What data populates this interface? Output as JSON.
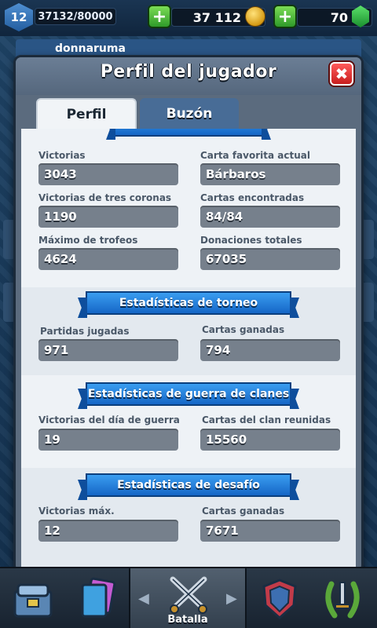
{
  "topbar": {
    "level": "12",
    "xp": "37132/80000",
    "gold": "37 112",
    "gems": "70",
    "player_name": "donnaruma"
  },
  "modal": {
    "title": "Perfil del jugador",
    "close_label": "✖",
    "tabs": [
      {
        "label": "Perfil",
        "active": true
      },
      {
        "label": "Buzón",
        "active": false
      }
    ]
  },
  "profile": {
    "stats": [
      {
        "label": "Victorias",
        "value": "3043"
      },
      {
        "label": "Carta favorita actual",
        "value": "Bárbaros"
      },
      {
        "label": "Victorias de tres coronas",
        "value": "1190"
      },
      {
        "label": "Cartas encontradas",
        "value": "84/84"
      },
      {
        "label": "Máximo de trofeos",
        "value": "4624"
      },
      {
        "label": "Donaciones totales",
        "value": "67035"
      }
    ]
  },
  "tournament": {
    "title": "Estadísticas de torneo",
    "stats": [
      {
        "label": "Partidas jugadas",
        "value": "971"
      },
      {
        "label": "Cartas ganadas",
        "value": "794"
      }
    ]
  },
  "clan_war": {
    "title": "Estadísticas de guerra de clanes",
    "stats": [
      {
        "label": "Victorias del día de guerra",
        "value": "19"
      },
      {
        "label": "Cartas del clan reunidas",
        "value": "15560"
      }
    ]
  },
  "challenge": {
    "title": "Estadísticas de desafío",
    "stats": [
      {
        "label": "Victorias máx.",
        "value": "12"
      },
      {
        "label": "Cartas ganadas",
        "value": "7671"
      }
    ]
  },
  "bottom_nav": {
    "active_label": "Batalla",
    "items": [
      "shop-icon",
      "cards-icon",
      "battle-swords-icon",
      "clan-icon",
      "tournament-laurel-icon"
    ]
  },
  "colors": {
    "ribbon": "#1f7fd9",
    "stat_box": "#76808c",
    "close": "#d62b2b"
  }
}
